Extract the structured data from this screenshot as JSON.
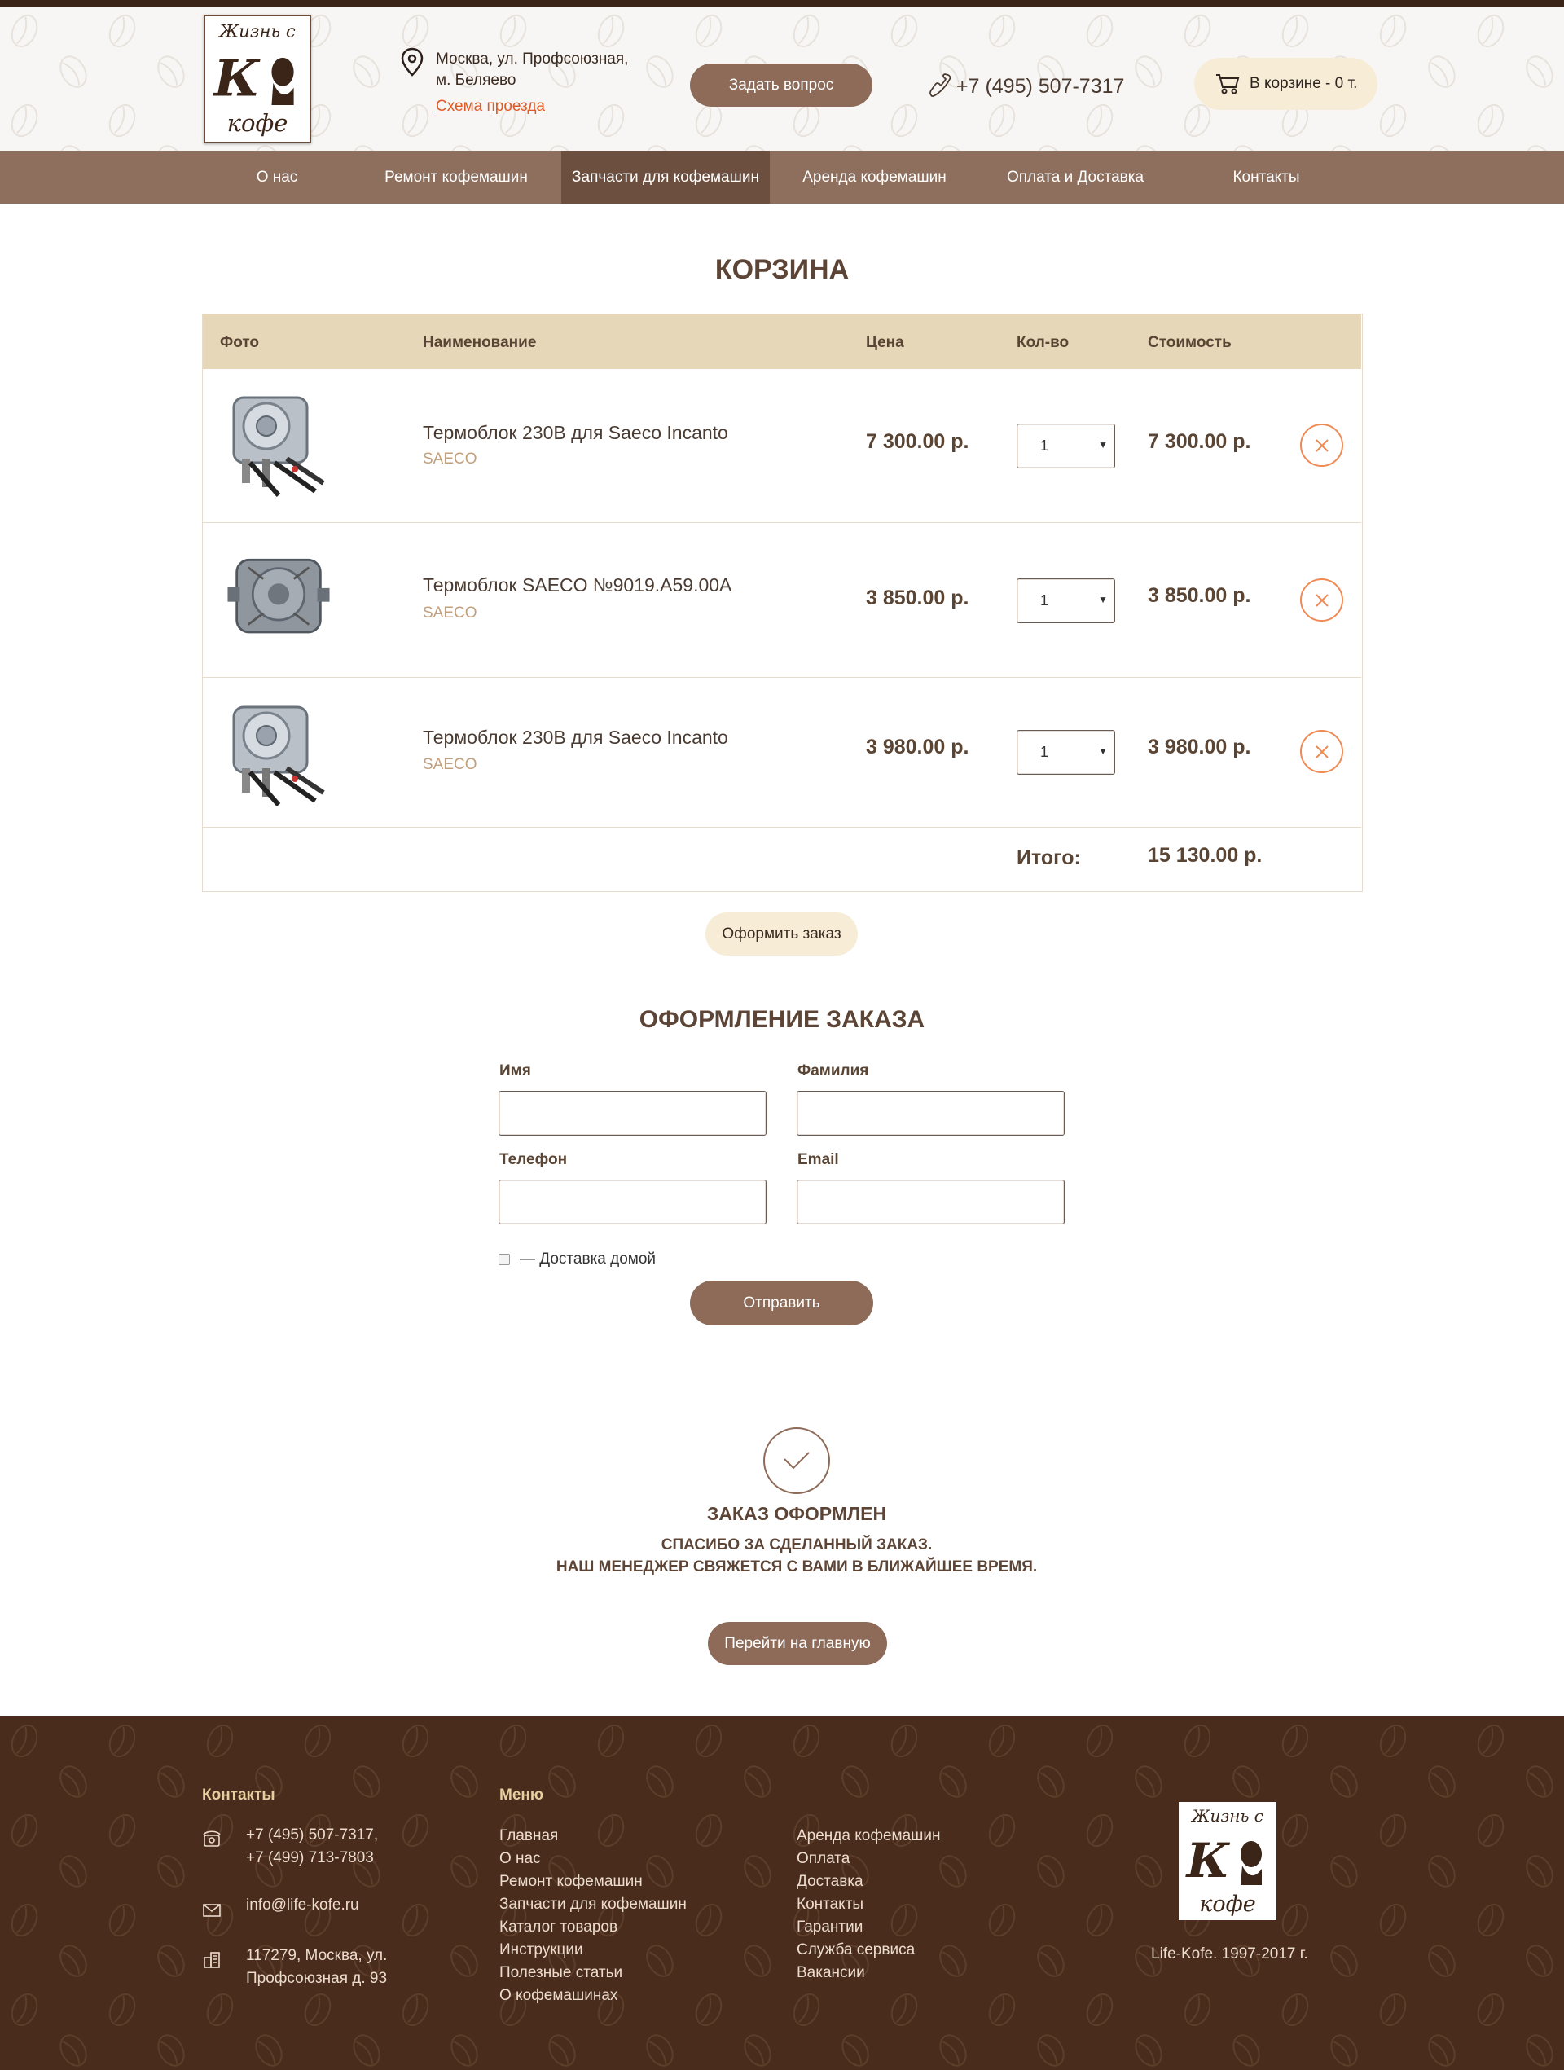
{
  "header": {
    "logo_line1": "Жизнь с",
    "logo_line2": "кофе",
    "address_line1": "Москва, ул. Профсоюзная,",
    "address_line2": "м. Беляево",
    "directions_link": "Схема проезда",
    "ask_button": "Задать вопрос",
    "phone": "+7 (495) 507-7317",
    "cart_label": "В корзине - 0 т."
  },
  "nav": {
    "items": [
      {
        "label": "О нас"
      },
      {
        "label": "Ремонт кофемашин"
      },
      {
        "label": "Запчасти для кофемашин",
        "active": true
      },
      {
        "label": "Аренда кофемашин"
      },
      {
        "label": "Оплата и Доставка"
      },
      {
        "label": "Контакты"
      }
    ]
  },
  "cart": {
    "title": "КОРЗИНА",
    "columns": [
      "Фото",
      "Наименование",
      "Цена",
      "Кол-во",
      "Стоимость"
    ],
    "items": [
      {
        "name": "Термоблок 230В для Saeco Incanto",
        "brand": "SAECO",
        "price": "7 300.00 р.",
        "qty": "1",
        "total": "7 300.00 р.",
        "image": "thermoblock-icon"
      },
      {
        "name": "Термоблок SAECO №9019.A59.00A",
        "brand": "SAECO",
        "price": "3 850.00 р.",
        "qty": "1",
        "total": "3 850.00 р.",
        "image": "thermoblock-icon"
      },
      {
        "name": "Термоблок 230В для Saeco Incanto",
        "brand": "SAECO",
        "price": "3 980.00 р.",
        "qty": "1",
        "total": "3 980.00 р.",
        "image": "thermoblock-icon"
      }
    ],
    "total_label": "Итого:",
    "total_value": "15 130.00 р.",
    "order_button": "Оформить заказ"
  },
  "checkout": {
    "title": "ОФОРМЛЕНИЕ ЗАКАЗА",
    "first_name_label": "Имя",
    "last_name_label": "Фамилия",
    "phone_label": "Телефон",
    "email_label": "Email",
    "delivery_label": "— Доставка домой",
    "submit_button": "Отправить"
  },
  "confirmation": {
    "title": "ЗАКАЗ ОФОРМЛЕН",
    "line1": "СПАСИБО ЗА СДЕЛАННЫЙ ЗАКАЗ.",
    "line2": "НАШ МЕНЕДЖЕР СВЯЖЕТСЯ С ВАМИ В БЛИЖАЙШЕЕ ВРЕМЯ.",
    "home_button": "Перейти на главную"
  },
  "footer": {
    "contacts_title": "Контакты",
    "phone1": "+7 (495) 507-7317,",
    "phone2": "+7 (499) 713-7803",
    "email": "info@life-kofe.ru",
    "address1": "117279, Москва, ул.",
    "address2": "Профсоюзная д. 93",
    "menu_title": "Меню",
    "menu_col1": [
      "Главная",
      "О нас",
      "Ремонт кофемашин",
      "Запчасти для кофемашин",
      "Каталог товаров",
      "Инструкции",
      "Полезные статьи",
      "О кофемашинах"
    ],
    "menu_col2": [
      "Аренда кофемашин",
      "Оплата",
      "Доставка",
      "Контакты",
      "Гарантии",
      "Служба сервиса",
      "Вакансии"
    ],
    "copyright": "Life-Kofe. 1997-2017 г."
  },
  "colors": {
    "brand_brown": "#8d6b58",
    "nav_brown": "#8e6f5d",
    "footer_brown": "#4a2c1c",
    "accent_orange": "#e05a25",
    "cream": "#f7ecd6"
  }
}
